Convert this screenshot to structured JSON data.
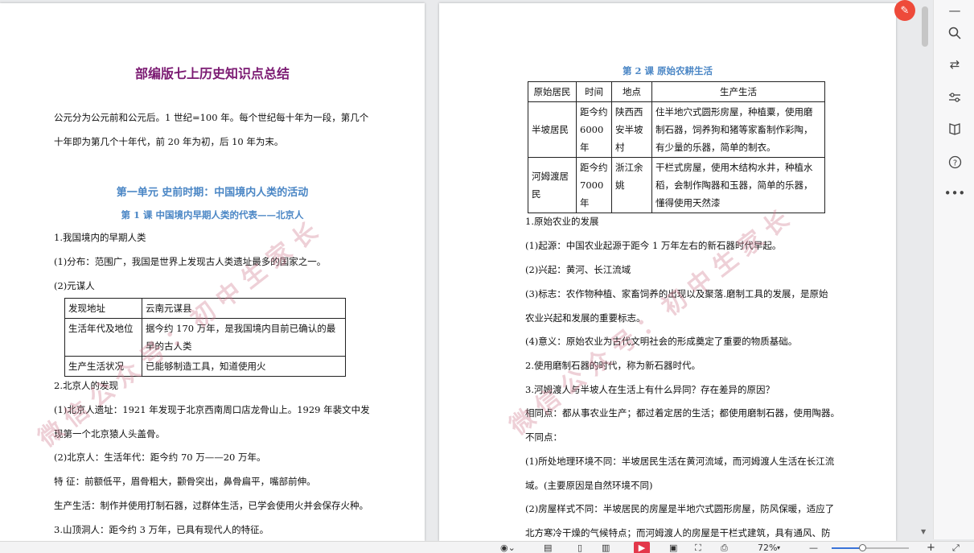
{
  "left_page": {
    "doc_title": "部编版七上历史知识点总结",
    "intro_lines": [
      "公元分为公元前和公元后。1 世纪=100 年。每个世纪每十年为一段，第几个",
      "十年即为第几个十年代，前 20 年为初，后 10 年为末。"
    ],
    "unit_title": "第一单元  史前时期：中国境内人类的活动",
    "lesson_title": "第 1 课  中国境内早期人类的代表——北京人",
    "lines_a": [
      "1.我国境内的早期人类",
      "(1)分布：范围广，我国是世界上发现古人类遗址最多的国家之一。",
      "(2)元谋人"
    ],
    "yuanmou_table": [
      [
        "发现地址",
        "云南元谋县"
      ],
      [
        "生活年代及地位",
        "据今约 170 万年，是我国境内目前已确认的最早的古人类"
      ],
      [
        "生产生活状况",
        "已能够制造工具，知道使用火"
      ]
    ],
    "lines_b": [
      "2.北京人的发现",
      "(1)北京人遗址：1921 年发现于北京西南周口店龙骨山上。1929 年裴文中发",
      "现第一个北京猿人头盖骨。",
      "(2)北京人：生活年代：距今约 70 万——20 万年。",
      "特  征：前额低平，眉骨粗大，颧骨突出，鼻骨扁平，嘴部前伸。",
      "生产生活：制作并使用打制石器，过群体生活，已学会使用火并会保存火种。",
      "3.山顶洞人：距今约 3 万年，已具有现代人的特征。"
    ],
    "watermark": "微信公众号：初中生家长"
  },
  "right_page": {
    "lesson_title": "第 2 课   原始农耕生活",
    "table_headers": [
      "原始居民",
      "时间",
      "地点",
      "生产生活"
    ],
    "table_rows": [
      [
        "半坡居民",
        "距今约6000年",
        "陕西西安半坡村",
        "住半地穴式圆形房屋，种植粟，使用磨制石器，饲养狗和猪等家畜制作彩陶，有少量的乐器，简单的制衣。"
      ],
      [
        "河姆渡居民",
        "距今约7000年",
        "浙江余姚",
        "干栏式房屋，使用木结构水井，种植水稻，会制作陶器和玉器，简单的乐器，懂得使用天然漆"
      ]
    ],
    "lines": [
      "1.原始农业的发展",
      "(1)起源：中国农业起源于距今 1 万年左右的新石器时代早起。",
      "(2)兴起：黄河、长江流域",
      "(3)标志：农作物种植、家畜饲养的出现以及聚落.磨制工具的发展，是原始",
      "农业兴起和发展的重要标志。",
      "(4)意义：原始农业为古代文明社会的形成奠定了重要的物质基础。",
      "2.使用磨制石器的时代，称为新石器时代。",
      "3.河姆渡人与半坡人在生活上有什么异同？存在差异的原因？",
      "相同点：都从事农业生产；都过着定居的生活；都使用磨制石器，使用陶器。",
      "不同点：",
      "(1)所处地理环境不同：半坡居民生活在黄河流域，而河姆渡人生活在长江流",
      "域。(主要原因是自然环境不同)",
      "(2)房屋样式不同：半坡居民的房屋是半地穴式圆形房屋，防风保暖，适应了",
      "北方寒冷干燥的气候特点；而河姆渡人的房屋是干栏式建筑，具有通风、防"
    ],
    "watermark": "微信公众号：初中生家长"
  },
  "sidebar": {
    "icons": [
      "minimize-icon",
      "search-icon",
      "translate-icon",
      "filter-icon",
      "book-icon",
      "help-icon",
      "more-icon"
    ]
  },
  "statusbar": {
    "zoom_label": "72%",
    "zoom_percent": 72
  },
  "colors": {
    "title_purple": "#7b1a72",
    "heading_blue": "#4a86c5",
    "watermark": "#cd788c",
    "badge_red": "#ee4a3a",
    "accent_blue": "#3a73d8"
  }
}
